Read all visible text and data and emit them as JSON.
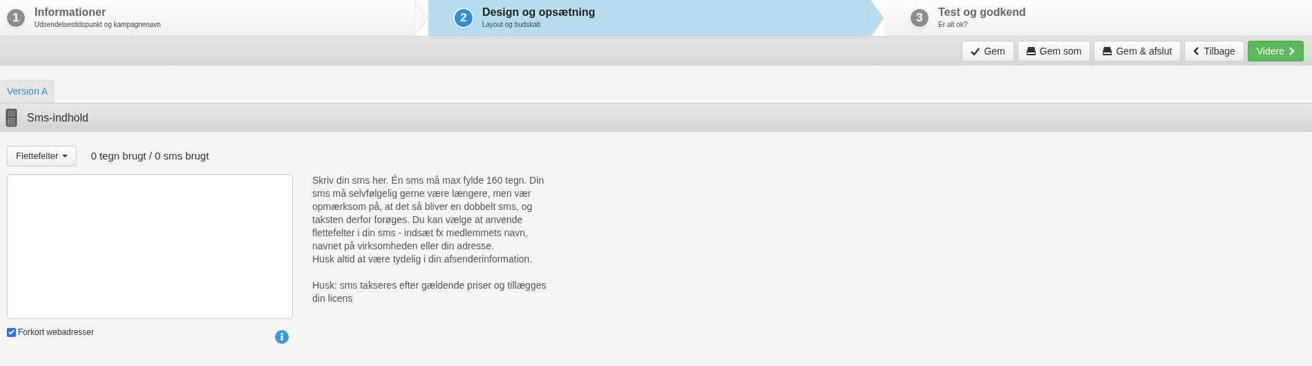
{
  "steps": [
    {
      "number": "1",
      "title": "Informationer",
      "subtitle": "Udsendelsestidspunkt og kampagnenavn",
      "selected": false
    },
    {
      "number": "2",
      "title": "Design og opsætning",
      "subtitle": "Layout og budskab",
      "selected": true
    },
    {
      "number": "3",
      "title": "Test og godkend",
      "subtitle": "Er alt ok?",
      "selected": false
    }
  ],
  "toolbar": [
    {
      "label": "Gem",
      "kind": "check"
    },
    {
      "label": "Gem som",
      "kind": "drive"
    },
    {
      "label": "Gem & afslut",
      "kind": "drive"
    },
    {
      "label": "Tilbage",
      "kind": "back"
    },
    {
      "label": "Videre",
      "kind": "next"
    }
  ],
  "tabs": [
    {
      "label": "Version A",
      "selected": true
    }
  ],
  "section": {
    "title": "Sms-indhold"
  },
  "merge_fields": {
    "label": "Flettefelter"
  },
  "counter": "0 tegn brugt / 0 sms brugt",
  "shorten_urls": {
    "label": "Forkort webadresser",
    "checked": true
  },
  "help": [
    [
      "Skriv din sms her. Én sms må max fylde 160 tegn. Din sms må selvfølgelig gerne være længere, men vær opmærksom på, at det så bliver en dobbelt sms, og taksten derfor forøges. Du kan vælge at anvende flettefelter i din sms - indsæt fx medlemmets navn, navnet på virksomheden eller din adresse.",
      "Husk altid at være tydelig i din afsenderinformation."
    ],
    [
      "Husk: sms takseres efter gældende priser og tillægges din licens"
    ]
  ]
}
